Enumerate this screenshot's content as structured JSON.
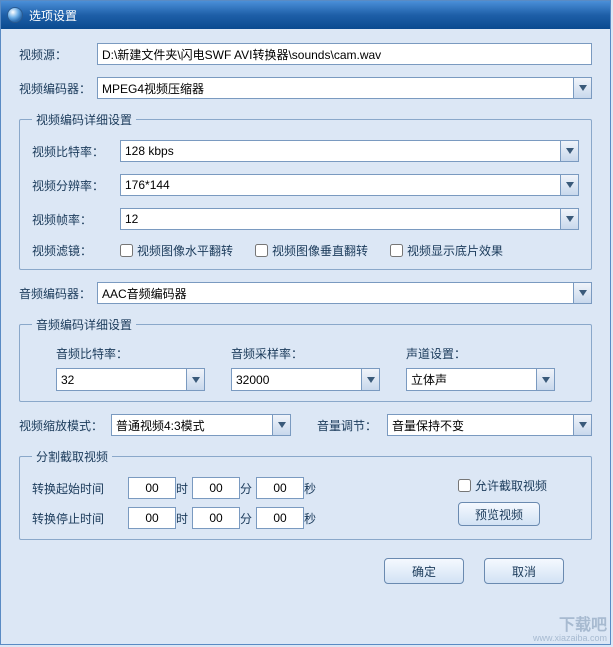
{
  "window": {
    "title": "选项设置"
  },
  "source": {
    "label": "视频源：",
    "value": "D:\\新建文件夹\\闪电SWF AVI转换器\\sounds\\cam.wav"
  },
  "video_encoder": {
    "label": "视频编码器：",
    "value": "MPEG4视频压缩器"
  },
  "video_group": {
    "legend": "视频编码详细设置",
    "bitrate": {
      "label": "视频比特率：",
      "value": "128 kbps"
    },
    "resolution": {
      "label": "视频分辨率：",
      "value": "176*144"
    },
    "fps": {
      "label": "视频帧率：",
      "value": "12"
    },
    "filter_label": "视频滤镜：",
    "flip_h": "视频图像水平翻转",
    "flip_v": "视频图像垂直翻转",
    "show_base": "视频显示底片效果"
  },
  "audio_encoder": {
    "label": "音频编码器：",
    "value": "AAC音频编码器"
  },
  "audio_group": {
    "legend": "音频编码详细设置",
    "bitrate": {
      "label": "音频比特率：",
      "value": "32"
    },
    "samplerate": {
      "label": "音频采样率：",
      "value": "32000"
    },
    "channel": {
      "label": "声道设置：",
      "value": "立体声"
    }
  },
  "scale": {
    "label": "视频缩放模式：",
    "value": "普通视频4:3模式"
  },
  "volume": {
    "label": "音量调节：",
    "value": "音量保持不变"
  },
  "segment": {
    "legend": "分割截取视频",
    "start_label": "转换起始时间",
    "stop_label": "转换停止时间",
    "h": "00",
    "m": "00",
    "s": "00",
    "unit_h": "时",
    "unit_m": "分",
    "unit_s": "秒",
    "allow": "允许截取视频",
    "preview": "预览视频"
  },
  "buttons": {
    "ok": "确定",
    "cancel": "取消"
  },
  "watermark": {
    "big": "下载吧",
    "small": "www.xiazaiba.com"
  }
}
